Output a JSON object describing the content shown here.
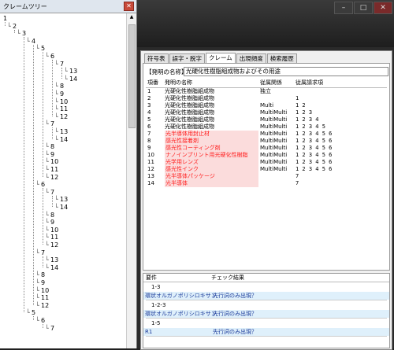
{
  "window": {
    "min": "–",
    "max": "□",
    "close": "✕"
  },
  "tree": {
    "title": "クレームツリー",
    "close_glyph": "✕",
    "nodes": [
      {
        "label": "1",
        "depth": 0
      },
      {
        "label": "2",
        "depth": 1
      },
      {
        "label": "3",
        "depth": 2
      },
      {
        "label": "4",
        "depth": 3
      },
      {
        "label": "5",
        "depth": 4
      },
      {
        "label": "6",
        "depth": 5
      },
      {
        "label": "7",
        "depth": 6
      },
      {
        "label": "13",
        "depth": 7
      },
      {
        "label": "14",
        "depth": 7
      },
      {
        "label": "8",
        "depth": 6
      },
      {
        "label": "9",
        "depth": 6
      },
      {
        "label": "10",
        "depth": 6
      },
      {
        "label": "11",
        "depth": 6
      },
      {
        "label": "12",
        "depth": 6
      },
      {
        "label": "7",
        "depth": 5
      },
      {
        "label": "13",
        "depth": 6
      },
      {
        "label": "14",
        "depth": 6
      },
      {
        "label": "8",
        "depth": 5
      },
      {
        "label": "9",
        "depth": 5
      },
      {
        "label": "10",
        "depth": 5
      },
      {
        "label": "11",
        "depth": 5
      },
      {
        "label": "12",
        "depth": 5
      },
      {
        "label": "6",
        "depth": 4
      },
      {
        "label": "7",
        "depth": 5
      },
      {
        "label": "13",
        "depth": 6
      },
      {
        "label": "14",
        "depth": 6
      },
      {
        "label": "8",
        "depth": 5
      },
      {
        "label": "9",
        "depth": 5
      },
      {
        "label": "10",
        "depth": 5
      },
      {
        "label": "11",
        "depth": 5
      },
      {
        "label": "12",
        "depth": 5
      },
      {
        "label": "7",
        "depth": 4
      },
      {
        "label": "13",
        "depth": 5
      },
      {
        "label": "14",
        "depth": 5
      },
      {
        "label": "8",
        "depth": 4
      },
      {
        "label": "9",
        "depth": 4
      },
      {
        "label": "10",
        "depth": 4
      },
      {
        "label": "11",
        "depth": 4
      },
      {
        "label": "12",
        "depth": 4
      },
      {
        "label": "5",
        "depth": 3
      },
      {
        "label": "6",
        "depth": 4
      },
      {
        "label": "7",
        "depth": 5
      }
    ]
  },
  "tabs": [
    "符号表",
    "誤字・脱字",
    "クレーム",
    "出現頻度",
    "検索履歴"
  ],
  "active_tab": 2,
  "invention": {
    "label": "【発明の名称】",
    "value": "光硬化性樹脂組成物およびその用途"
  },
  "table": {
    "headers": {
      "no": "項番",
      "name": "発明の名称",
      "rel": "従属関係",
      "dep": "従属請求項"
    },
    "rows": [
      {
        "no": "1",
        "name": "光硬化性樹脂組成物",
        "rel": "独立",
        "dep": "",
        "red": false
      },
      {
        "no": "2",
        "name": "光硬化性樹脂組成物",
        "rel": "",
        "dep": "1",
        "red": false
      },
      {
        "no": "3",
        "name": "光硬化性樹脂組成物",
        "rel": "Multi",
        "dep": "1 2",
        "red": false
      },
      {
        "no": "4",
        "name": "光硬化性樹脂組成物",
        "rel": "MultiMulti",
        "dep": "1 2 3",
        "red": false
      },
      {
        "no": "5",
        "name": "光硬化性樹脂組成物",
        "rel": "MultiMulti",
        "dep": "1 2 3 4",
        "red": false
      },
      {
        "no": "6",
        "name": "光硬化性樹脂組成物",
        "rel": "MultiMulti",
        "dep": "1 2 3 4 5",
        "red": false
      },
      {
        "no": "7",
        "name": "光半導体用封止材",
        "rel": "MultiMulti",
        "dep": "1 2 3 4 5 6",
        "red": true
      },
      {
        "no": "8",
        "name": "感光性接着剤",
        "rel": "MultiMulti",
        "dep": "1 2 3 4 5 6",
        "red": true
      },
      {
        "no": "9",
        "name": "感光性コーティング剤",
        "rel": "MultiMulti",
        "dep": "1 2 3 4 5 6",
        "red": true
      },
      {
        "no": "10",
        "name": "ナノインプリント用光硬化性樹脂",
        "rel": "MultiMulti",
        "dep": "1 2 3 4 5 6",
        "red": true
      },
      {
        "no": "11",
        "name": "光学用レンズ",
        "rel": "MultiMulti",
        "dep": "1 2 3 4 5 6",
        "red": true
      },
      {
        "no": "12",
        "name": "感光性インク",
        "rel": "MultiMulti",
        "dep": "1 2 3 4 5 6",
        "red": true
      },
      {
        "no": "13",
        "name": "光半導体パッケージ",
        "rel": "",
        "dep": "            7",
        "red": true
      },
      {
        "no": "14",
        "name": "光半導体",
        "rel": "",
        "dep": "            7",
        "red": true
      }
    ]
  },
  "check": {
    "headers": {
      "req": "要件",
      "result": "チェック結果"
    },
    "entries": [
      {
        "id": "1-3",
        "term": "環状オルガノポリシロキサン",
        "result": "先行詞のみ出現？"
      },
      {
        "id": "1-2-3",
        "term": "環状オルガノポリシロキサン",
        "result": "先行詞のみ出現？"
      },
      {
        "id": "1-5",
        "term": "R1",
        "result": "先行詞のみ出現？"
      }
    ]
  }
}
